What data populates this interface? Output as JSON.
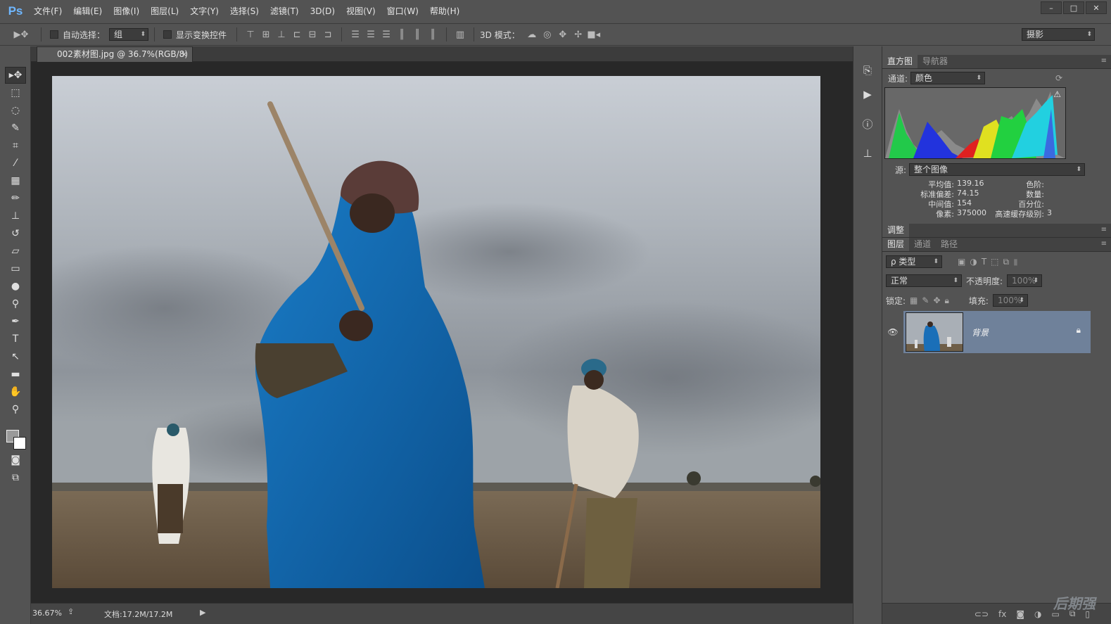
{
  "app": {
    "logo": "Ps"
  },
  "menu": [
    "文件(F)",
    "编辑(E)",
    "图像(I)",
    "图层(L)",
    "文字(Y)",
    "选择(S)",
    "滤镜(T)",
    "3D(D)",
    "视图(V)",
    "窗口(W)",
    "帮助(H)"
  ],
  "window_controls": {
    "minimize": "–",
    "maximize": "□",
    "close": "✕"
  },
  "options": {
    "move_icon": "▶✥",
    "auto_select_label": "自动选择：",
    "auto_select_value": "组",
    "show_transform_label": "显示变换控件",
    "mode3d_label": "3D 模式：",
    "workspace": "摄影"
  },
  "document": {
    "tab_title": "002素材图.jpg @ 36.7%(RGB/8)",
    "tab_close": "×",
    "zoom": "36.67%",
    "doc_size": "文档:17.2M/17.2M",
    "status_arrow": "▶"
  },
  "histogram": {
    "tabs": [
      "直方图",
      "导航器"
    ],
    "channel_label": "通道:",
    "channel_value": "颜色",
    "source_label": "源:",
    "source_value": "整个图像",
    "warning": "⚠",
    "stats": {
      "mean_label": "平均值:",
      "mean": "139.16",
      "std_label": "标准偏差:",
      "std": "74.15",
      "median_label": "中间值:",
      "median": "154",
      "pixels_label": "像素:",
      "pixels": "375000",
      "level_label": "色阶:",
      "count_label": "数量:",
      "percentile_label": "百分位:",
      "cache_label": "高速缓存级别:",
      "cache": "3"
    }
  },
  "adjust": {
    "tab": "调整"
  },
  "layers": {
    "tabs": [
      "图层",
      "通道",
      "路径"
    ],
    "filter_value": "ρ 类型",
    "blend_mode": "正常",
    "opacity_label": "不透明度:",
    "opacity_value": "100%",
    "lock_label": "锁定:",
    "fill_label": "填充:",
    "fill_value": "100%",
    "layer_name": "背景"
  },
  "watermark": "后期强",
  "colors": {
    "accent": "#6fb7ff",
    "selected_layer": "#6f819a",
    "panel": "#535353"
  }
}
